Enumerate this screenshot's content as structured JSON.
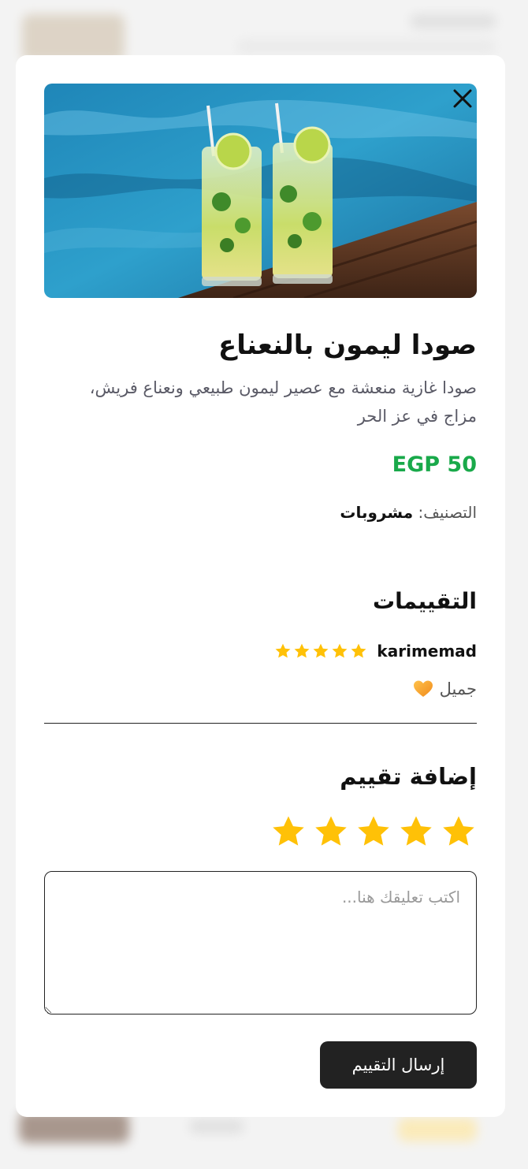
{
  "product": {
    "title": "صودا ليمون بالنعناع",
    "description": "صودا غازية منعشة مع عصير ليمون طبيعي ونعناع فريش، مزاج في عز الحر",
    "price": "EGP 50",
    "category_label": "التصنيف:",
    "category_value": "مشروبات"
  },
  "reviews": {
    "title": "التقييمات",
    "items": [
      {
        "user": "karimemad",
        "rating": 5,
        "comment": "جميل"
      }
    ]
  },
  "add_review": {
    "title": "إضافة تقييم",
    "rating": 5,
    "comment_placeholder": "اكتب تعليقك هنا...",
    "submit_label": "إرسال التقييم"
  },
  "colors": {
    "price": "#19a94a",
    "star": "#ffc107",
    "button_bg": "#222222"
  },
  "icons": {
    "close": "close-icon",
    "star": "star-icon",
    "heart": "orange-heart-icon"
  }
}
